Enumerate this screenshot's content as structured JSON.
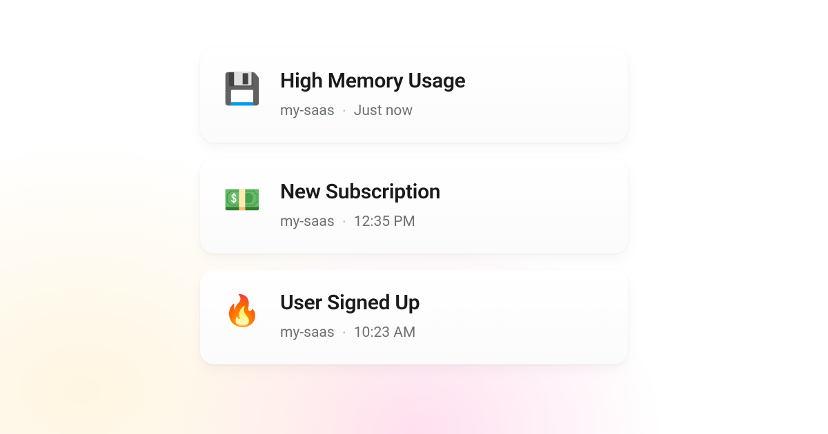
{
  "notifications": [
    {
      "icon": "💾",
      "icon_name": "floppy-disk-icon",
      "title": "High Memory Usage",
      "project": "my-saas",
      "time": "Just now"
    },
    {
      "icon": "💵",
      "icon_name": "dollar-banknote-icon",
      "title": "New Subscription",
      "project": "my-saas",
      "time": "12:35 PM"
    },
    {
      "icon": "🔥",
      "icon_name": "fire-icon",
      "title": "User Signed Up",
      "project": "my-saas",
      "time": "10:23 AM"
    }
  ],
  "separator": "•"
}
